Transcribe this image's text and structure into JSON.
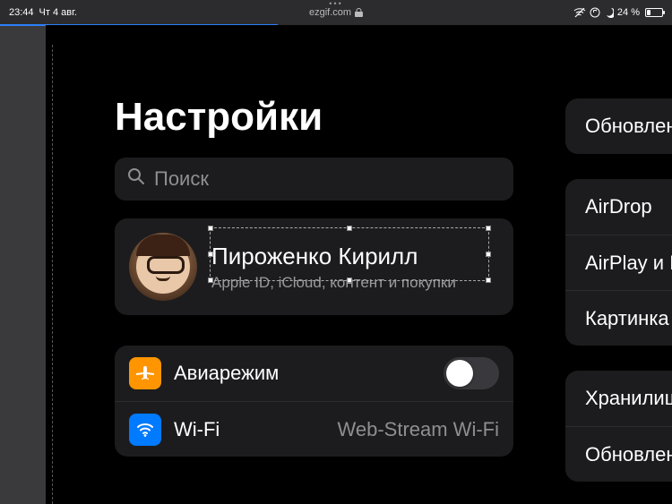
{
  "statusbar": {
    "time": "23:44",
    "date": "Чт 4 авг.",
    "battery_percent": "24 %",
    "url": "ezgif.com"
  },
  "settings": {
    "title": "Настройки",
    "search_placeholder": "Поиск",
    "apple_id": {
      "name": "Пироженко Кирилл",
      "subtitle": "Apple ID, iCloud, контент и покупки"
    },
    "rows": {
      "airplane": "Авиарежим",
      "wifi": "Wi-Fi",
      "wifi_value": "Web-Stream Wi-Fi"
    }
  },
  "right_panel": {
    "group1": {
      "update": "Обновление"
    },
    "group2": {
      "airdrop": "AirDrop",
      "airplay": "AirPlay и На",
      "pip": "Картинка в"
    },
    "group3": {
      "storage": "Хранилище",
      "update2": "Обновление"
    }
  }
}
